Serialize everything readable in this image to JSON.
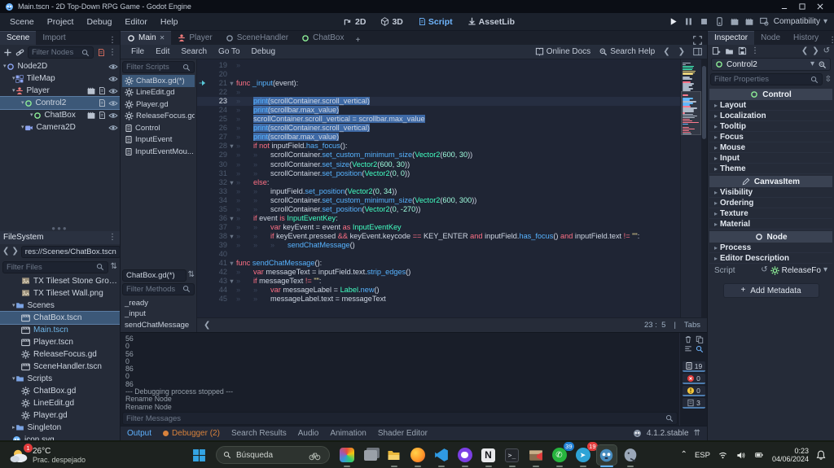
{
  "window": {
    "title": "Main.tscn - 2D Top-Down RPG Game - Godot Engine"
  },
  "menubar": {
    "menus": [
      "Scene",
      "Project",
      "Debug",
      "Editor",
      "Help"
    ],
    "workspaces": [
      {
        "label": "2D",
        "icon": "ws2d",
        "active": false
      },
      {
        "label": "3D",
        "icon": "ws3d",
        "active": false
      },
      {
        "label": "Script",
        "icon": "script",
        "active": true
      },
      {
        "label": "AssetLib",
        "icon": "assetlib",
        "active": false
      }
    ],
    "playback": [
      "play",
      "pause",
      "stop",
      "remote",
      "movie",
      "movie2",
      "screen"
    ],
    "renderer": "Compatibility"
  },
  "scene_dock": {
    "tabs": [
      {
        "label": "Scene",
        "active": true
      },
      {
        "label": "Import",
        "active": false
      }
    ],
    "filter_placeholder": "Filter Nodes",
    "tree": [
      {
        "name": "Node2D",
        "icon": "node2d",
        "depth": 0,
        "badges": [],
        "selected": false
      },
      {
        "name": "TileMap",
        "icon": "tilemap",
        "depth": 1,
        "badges": [],
        "selected": false
      },
      {
        "name": "Player",
        "icon": "person",
        "depth": 1,
        "badges": [
          "movie",
          "script"
        ],
        "selected": false
      },
      {
        "name": "Control2",
        "icon": "control",
        "depth": 2,
        "badges": [
          "script"
        ],
        "selected": true
      },
      {
        "name": "ChatBox",
        "icon": "control",
        "depth": 3,
        "badges": [
          "movie",
          "script"
        ],
        "selected": false
      },
      {
        "name": "Camera2D",
        "icon": "camera",
        "depth": 2,
        "badges": [],
        "selected": false
      }
    ]
  },
  "filesystem": {
    "title": "FileSystem",
    "path": "res://Scenes/ChatBox.tscn",
    "filter_placeholder": "Filter Files",
    "tree": [
      {
        "label": "TX Tileset Stone Ground.png",
        "icon": "img",
        "depth": 2,
        "selected": false,
        "accent": false
      },
      {
        "label": "TX Tileset Wall.png",
        "icon": "img",
        "depth": 2,
        "selected": false,
        "accent": false
      },
      {
        "label": "Scenes",
        "icon": "folder",
        "depth": 1,
        "expanded": true,
        "accent": false
      },
      {
        "label": "ChatBox.tscn",
        "icon": "scene",
        "depth": 2,
        "selected": true,
        "accent": false
      },
      {
        "label": "Main.tscn",
        "icon": "scene",
        "depth": 2,
        "selected": false,
        "accent": true
      },
      {
        "label": "Player.tscn",
        "icon": "scene",
        "depth": 2,
        "selected": false,
        "accent": false
      },
      {
        "label": "ReleaseFocus.gd",
        "icon": "gear",
        "depth": 2,
        "selected": false,
        "accent": false
      },
      {
        "label": "SceneHandler.tscn",
        "icon": "scene",
        "depth": 2,
        "selected": false,
        "accent": false
      },
      {
        "label": "Scripts",
        "icon": "folder",
        "depth": 1,
        "expanded": true,
        "accent": false
      },
      {
        "label": "ChatBox.gd",
        "icon": "gear",
        "depth": 2,
        "selected": false,
        "accent": false
      },
      {
        "label": "LineEdit.gd",
        "icon": "gear",
        "depth": 2,
        "selected": false,
        "accent": false
      },
      {
        "label": "Player.gd",
        "icon": "gear",
        "depth": 2,
        "selected": false,
        "accent": false
      },
      {
        "label": "Singleton",
        "icon": "folder",
        "depth": 1,
        "expanded": false,
        "accent": false
      },
      {
        "label": "icon.svg",
        "icon": "godot",
        "depth": 1,
        "selected": false,
        "accent": false
      }
    ]
  },
  "scene_tabs": [
    {
      "label": "Main",
      "icon": "circle",
      "active": true,
      "close": true
    },
    {
      "label": "Player",
      "icon": "person",
      "active": false,
      "close": false
    },
    {
      "label": "SceneHandler",
      "icon": "circle",
      "active": false,
      "close": false
    },
    {
      "label": "ChatBox",
      "icon": "circle-green",
      "active": false,
      "close": false
    }
  ],
  "script_editor": {
    "menus": [
      "File",
      "Edit",
      "Search",
      "Go To",
      "Debug"
    ],
    "links": [
      "Online Docs",
      "Search Help"
    ],
    "filter_scripts_placeholder": "Filter Scripts",
    "scripts": [
      {
        "label": "ChatBox.gd(*)",
        "icon": "gear",
        "selected": true
      },
      {
        "label": "LineEdit.gd",
        "icon": "gear",
        "selected": false
      },
      {
        "label": "Player.gd",
        "icon": "gear",
        "selected": false
      },
      {
        "label": "ReleaseFocus.gd",
        "icon": "gear",
        "selected": false
      },
      {
        "label": "Control",
        "icon": "doc",
        "selected": false
      },
      {
        "label": "InputEvent",
        "icon": "doc",
        "selected": false
      },
      {
        "label": "InputEventMou...",
        "icon": "doc",
        "selected": false
      }
    ],
    "current_script": "ChatBox.gd(*)",
    "filter_methods_placeholder": "Filter Methods",
    "methods": [
      "_ready",
      "_input",
      "sendChatMessage"
    ],
    "status": {
      "line": "23",
      "column": "5",
      "indent": "Tabs"
    }
  },
  "code": {
    "lines": [
      {
        "n": 19,
        "ind": 1,
        "toks": []
      },
      {
        "n": 20,
        "ind": 0,
        "toks": []
      },
      {
        "n": 21,
        "ind": 0,
        "fold": true,
        "conn": true,
        "toks": [
          [
            "k",
            "func "
          ],
          [
            "f",
            "_input"
          ],
          [
            "w",
            "(event):"
          ]
        ]
      },
      {
        "n": 22,
        "ind": 1,
        "toks": []
      },
      {
        "n": 23,
        "ind": 1,
        "sel": true,
        "cur": true,
        "toks": [
          [
            "f",
            "print"
          ],
          [
            "w",
            "(scrollContainer.scroll_vertical)"
          ]
        ]
      },
      {
        "n": 24,
        "ind": 1,
        "sel": true,
        "toks": [
          [
            "f",
            "print"
          ],
          [
            "w",
            "(scrollbar.max_value)"
          ]
        ]
      },
      {
        "n": 25,
        "ind": 1,
        "sel": true,
        "toks": [
          [
            "w",
            "scrollContainer.scroll_vertical = scrollbar.max_value"
          ]
        ]
      },
      {
        "n": 26,
        "ind": 1,
        "sel": true,
        "toks": [
          [
            "f",
            "print"
          ],
          [
            "w",
            "(scrollContainer.scroll_vertical)"
          ]
        ]
      },
      {
        "n": 27,
        "ind": 1,
        "sel": true,
        "toks": [
          [
            "f",
            "print"
          ],
          [
            "w",
            "(scrollbar.max_value)"
          ]
        ]
      },
      {
        "n": 28,
        "ind": 1,
        "fold": true,
        "toks": [
          [
            "k",
            "if not "
          ],
          [
            "w",
            "inputField."
          ],
          [
            "f",
            "has_focus"
          ],
          [
            "w",
            "():"
          ]
        ]
      },
      {
        "n": 29,
        "ind": 2,
        "toks": [
          [
            "w",
            "scrollContainer."
          ],
          [
            "f",
            "set_custom_minimum_size"
          ],
          [
            "w",
            "("
          ],
          [
            "t",
            "Vector2"
          ],
          [
            "w",
            "("
          ],
          [
            "n2",
            "600"
          ],
          [
            "w",
            ", "
          ],
          [
            "n2",
            "30"
          ],
          [
            "w",
            "))"
          ]
        ]
      },
      {
        "n": 30,
        "ind": 2,
        "toks": [
          [
            "w",
            "scrollContainer."
          ],
          [
            "f",
            "set_size"
          ],
          [
            "w",
            "("
          ],
          [
            "t",
            "Vector2"
          ],
          [
            "w",
            "("
          ],
          [
            "n2",
            "600"
          ],
          [
            "w",
            ", "
          ],
          [
            "n2",
            "30"
          ],
          [
            "w",
            "))"
          ]
        ]
      },
      {
        "n": 31,
        "ind": 2,
        "toks": [
          [
            "w",
            "scrollContainer."
          ],
          [
            "f",
            "set_position"
          ],
          [
            "w",
            "("
          ],
          [
            "t",
            "Vector2"
          ],
          [
            "w",
            "("
          ],
          [
            "n2",
            "0"
          ],
          [
            "w",
            ", "
          ],
          [
            "n2",
            "0"
          ],
          [
            "w",
            "))"
          ]
        ]
      },
      {
        "n": 32,
        "ind": 1,
        "fold": true,
        "toks": [
          [
            "k",
            "else"
          ],
          [
            "w",
            ":"
          ]
        ]
      },
      {
        "n": 33,
        "ind": 2,
        "toks": [
          [
            "w",
            "inputField."
          ],
          [
            "f",
            "set_position"
          ],
          [
            "w",
            "("
          ],
          [
            "t",
            "Vector2"
          ],
          [
            "w",
            "("
          ],
          [
            "n2",
            "0"
          ],
          [
            "w",
            ", "
          ],
          [
            "n2",
            "34"
          ],
          [
            "w",
            "))"
          ]
        ]
      },
      {
        "n": 34,
        "ind": 2,
        "toks": [
          [
            "w",
            "scrollContainer."
          ],
          [
            "f",
            "set_custom_minimum_size"
          ],
          [
            "w",
            "("
          ],
          [
            "t",
            "Vector2"
          ],
          [
            "w",
            "("
          ],
          [
            "n2",
            "600"
          ],
          [
            "w",
            ", "
          ],
          [
            "n2",
            "300"
          ],
          [
            "w",
            "))"
          ]
        ]
      },
      {
        "n": 35,
        "ind": 2,
        "toks": [
          [
            "w",
            "scrollContainer."
          ],
          [
            "f",
            "set_position"
          ],
          [
            "w",
            "("
          ],
          [
            "t",
            "Vector2"
          ],
          [
            "w",
            "("
          ],
          [
            "n2",
            "0"
          ],
          [
            "w",
            ", "
          ],
          [
            "n2",
            "-270"
          ],
          [
            "w",
            "))"
          ]
        ]
      },
      {
        "n": 36,
        "ind": 1,
        "fold": true,
        "toks": [
          [
            "k",
            "if "
          ],
          [
            "w",
            "event "
          ],
          [
            "k",
            "is "
          ],
          [
            "t",
            "InputEventKey"
          ],
          [
            "w",
            ":"
          ]
        ]
      },
      {
        "n": 37,
        "ind": 2,
        "toks": [
          [
            "k",
            "var "
          ],
          [
            "w",
            "keyEvent = event "
          ],
          [
            "k",
            "as "
          ],
          [
            "t",
            "InputEventKey"
          ]
        ]
      },
      {
        "n": 38,
        "ind": 2,
        "fold": true,
        "toks": [
          [
            "k",
            "if "
          ],
          [
            "w",
            "keyEvent.pressed "
          ],
          [
            "k",
            "&& "
          ],
          [
            "w",
            "keyEvent.keycode "
          ],
          [
            "k",
            "== "
          ],
          [
            "w",
            "KEY_ENTER "
          ],
          [
            "k",
            "and "
          ],
          [
            "w",
            "inputField."
          ],
          [
            "f",
            "has_focus"
          ],
          [
            "w",
            "() "
          ],
          [
            "k",
            "and "
          ],
          [
            "w",
            "inputField.text "
          ],
          [
            "k",
            "!= "
          ],
          [
            "s",
            "\"\""
          ],
          [
            "w",
            ":"
          ]
        ]
      },
      {
        "n": 39,
        "ind": 3,
        "toks": [
          [
            "f",
            "sendChatMessage"
          ],
          [
            "w",
            "()"
          ]
        ]
      },
      {
        "n": 40,
        "ind": 0,
        "toks": []
      },
      {
        "n": 41,
        "ind": 0,
        "fold": true,
        "toks": [
          [
            "k",
            "func "
          ],
          [
            "f",
            "sendChatMessage"
          ],
          [
            "w",
            "():"
          ]
        ]
      },
      {
        "n": 42,
        "ind": 1,
        "toks": [
          [
            "k",
            "var "
          ],
          [
            "w",
            "messageText = inputField.text."
          ],
          [
            "f",
            "strip_edges"
          ],
          [
            "w",
            "()"
          ]
        ]
      },
      {
        "n": 43,
        "ind": 1,
        "fold": true,
        "toks": [
          [
            "k",
            "if "
          ],
          [
            "w",
            "messageText "
          ],
          [
            "k",
            "!= "
          ],
          [
            "s",
            "\"\""
          ],
          [
            "w",
            ":"
          ]
        ]
      },
      {
        "n": 44,
        "ind": 2,
        "toks": [
          [
            "k",
            "var "
          ],
          [
            "w",
            "messageLabel = "
          ],
          [
            "t",
            "Label"
          ],
          [
            "w",
            "."
          ],
          [
            "f",
            "new"
          ],
          [
            "w",
            "()"
          ]
        ]
      },
      {
        "n": 45,
        "ind": 2,
        "toks": [
          [
            "w",
            "messageLabel.text = messageText"
          ]
        ]
      }
    ],
    "minimap_prefix": [
      [
        10,
        "w"
      ],
      [
        4,
        "w"
      ],
      [
        14,
        "t"
      ],
      [
        13,
        "t"
      ],
      [
        12,
        "t"
      ],
      [
        16,
        "s"
      ],
      [
        15,
        "s"
      ],
      [
        13,
        "s"
      ],
      [
        0,
        "w"
      ],
      [
        9,
        "w"
      ],
      [
        12,
        "w"
      ],
      [
        0,
        "w"
      ],
      [
        10,
        "k"
      ],
      [
        14,
        "w"
      ],
      [
        12,
        "w"
      ],
      [
        8,
        "w"
      ],
      [
        13,
        "w"
      ],
      [
        10,
        "w"
      ]
    ]
  },
  "output": {
    "lines": [
      "56",
      "0",
      "56",
      "0",
      "86",
      "0",
      "86",
      "--- Debugging process stopped ---",
      "Rename Node",
      "Rename Node"
    ],
    "filter_placeholder": "Filter Messages",
    "counts": [
      {
        "icon": "doc",
        "value": "19",
        "color": "#c3cbd8"
      },
      {
        "icon": "err",
        "value": "0",
        "color": "#e23c3c"
      },
      {
        "icon": "warn",
        "value": "0",
        "color": "#f2c63c"
      },
      {
        "icon": "edit",
        "value": "3",
        "color": "#c3cbd8"
      }
    ]
  },
  "bottom_bar": {
    "tabs": [
      {
        "label": "Output",
        "accent": true,
        "dot": false
      },
      {
        "label": "Debugger (2)",
        "warn": true,
        "dot": true
      },
      {
        "label": "Search Results"
      },
      {
        "label": "Audio"
      },
      {
        "label": "Animation"
      },
      {
        "label": "Shader Editor"
      }
    ],
    "version": "4.1.2.stable"
  },
  "inspector": {
    "tabs": [
      {
        "label": "Inspector",
        "active": true
      },
      {
        "label": "Node",
        "active": false
      },
      {
        "label": "History",
        "active": false
      }
    ],
    "node_name": "Control2",
    "filter_placeholder": "Filter Properties",
    "sections": [
      {
        "header": "Control",
        "icon": "circle-green",
        "groups": [
          "Layout",
          "Localization",
          "Tooltip",
          "Focus",
          "Mouse",
          "Input",
          "Theme"
        ]
      },
      {
        "header": "CanvasItem",
        "icon": "pencil",
        "groups": [
          "Visibility",
          "Ordering",
          "Texture",
          "Material"
        ]
      },
      {
        "header": "Node",
        "icon": "circle",
        "groups": [
          "Process",
          "Editor Description"
        ]
      }
    ],
    "script_row": {
      "label": "Script",
      "value": "ReleaseFo"
    },
    "add_metadata_label": "Add Metadata"
  },
  "taskbar": {
    "weather": {
      "temp": "26°C",
      "condition": "Prac. despejado",
      "badge": "1"
    },
    "search_placeholder": "Búsqueda",
    "apps": [
      {
        "name": "photos",
        "running": true
      },
      {
        "name": "stack",
        "running": false
      },
      {
        "name": "explorer",
        "running": true
      },
      {
        "name": "firefox",
        "running": true
      },
      {
        "name": "vscode",
        "running": true
      },
      {
        "name": "github",
        "running": true
      },
      {
        "name": "notion",
        "running": true
      },
      {
        "name": "terminal",
        "running": true
      },
      {
        "name": "game-tool",
        "running": true
      },
      {
        "name": "whatsapp",
        "running": true,
        "badge": "39",
        "badge_color": "#1f7fd4"
      },
      {
        "name": "telegram",
        "running": true,
        "badge": "19",
        "badge_color": "#e23c3c"
      },
      {
        "name": "godot",
        "running": true,
        "active": true
      },
      {
        "name": "postgres",
        "running": true
      }
    ],
    "tray": {
      "lang": "ESP",
      "time": "0:23",
      "date": "04/06/2024"
    }
  }
}
